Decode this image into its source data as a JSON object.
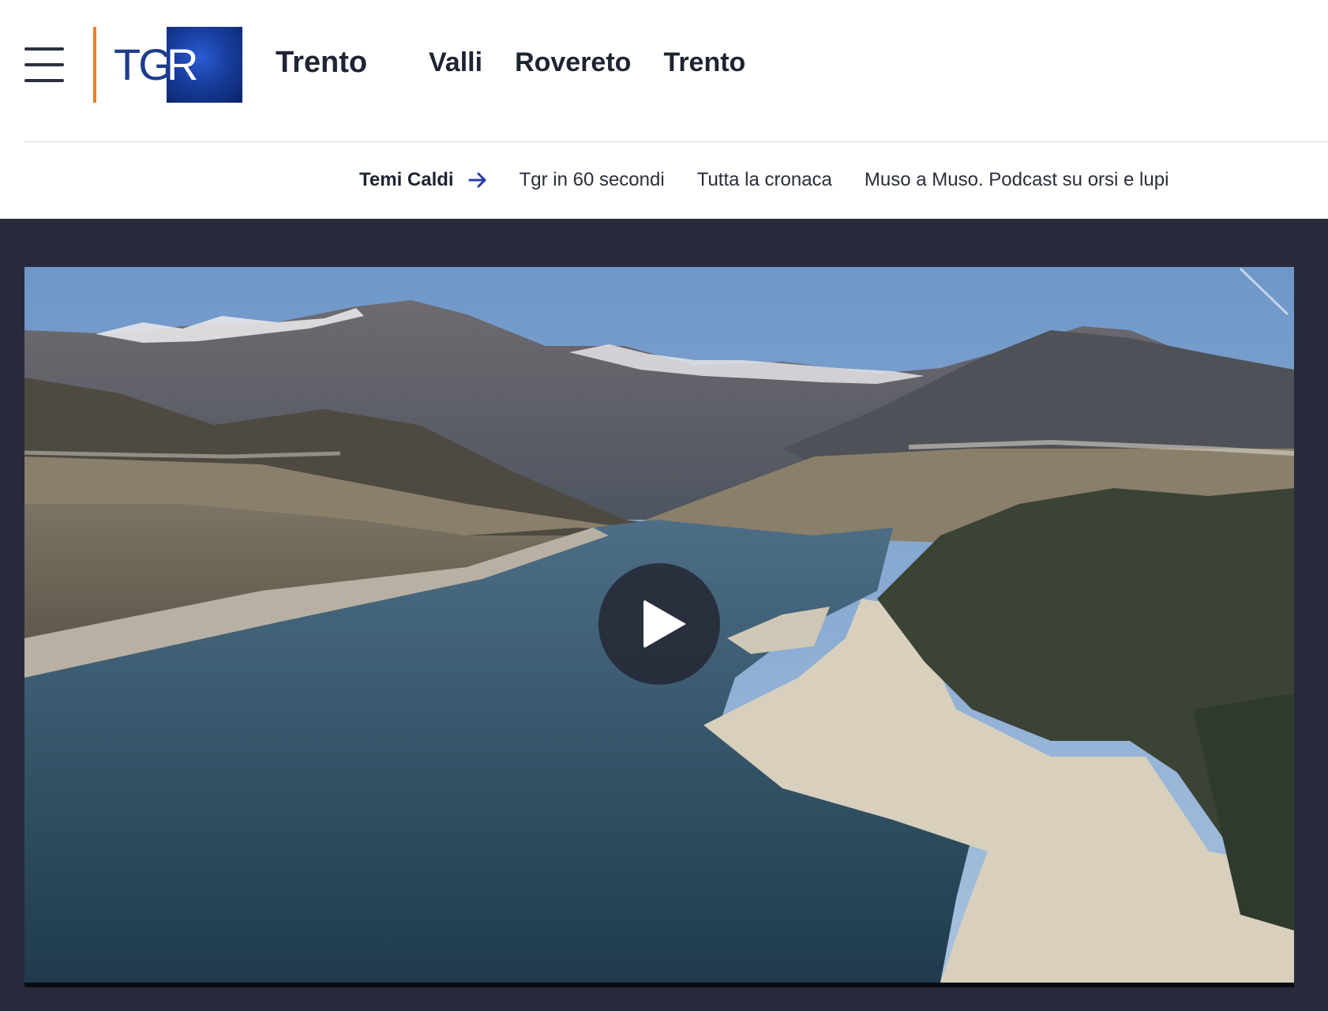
{
  "header": {
    "logo_text_tg": "TG",
    "logo_text_r": "R",
    "region": "Trento",
    "nav": [
      "Valli",
      "Rovereto",
      "Trento"
    ]
  },
  "subnav": {
    "hot_label": "Temi Caldi",
    "links": [
      "Tgr in 60 secondi",
      "Tutta la cronaca",
      "Muso a Muso. Podcast su orsi e lupi"
    ]
  },
  "colors": {
    "accent_orange": "#e8812b",
    "brand_blue": "#173e9e",
    "video_bg": "#282a3b",
    "text_dark": "#1f2433"
  },
  "icons": {
    "menu": "hamburger-icon",
    "arrow": "arrow-right-icon",
    "play": "play-icon"
  }
}
